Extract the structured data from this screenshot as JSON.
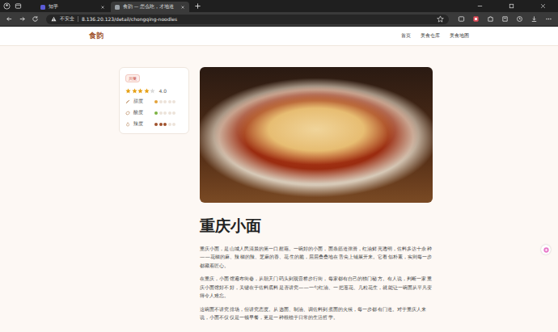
{
  "browser": {
    "tabs": [
      {
        "label": "知乎",
        "selected": false,
        "color": "#5b5bd6"
      },
      {
        "label": "食韵 — 怎么吃，才地道",
        "selected": true,
        "color": "#9aa0a6"
      }
    ],
    "security": "不安全",
    "url": "8.136.20.123/detail/chongqing-noodles"
  },
  "site": {
    "logo": "食韵",
    "nav": [
      {
        "label": "首页"
      },
      {
        "label": "美食仓库"
      },
      {
        "label": "美食地图"
      }
    ]
  },
  "dish": {
    "tag": "川菜",
    "stars": 4,
    "rating": "4.0",
    "flavors": [
      {
        "label": "甜度",
        "kind": "sweet",
        "level": 0.2,
        "color": "#e3a23b"
      },
      {
        "label": "酸度",
        "kind": "sour",
        "level": 0.2,
        "color": "#7cb342"
      },
      {
        "label": "辣度",
        "kind": "spicy",
        "level": 0.6,
        "color": "#a0522d"
      }
    ],
    "title": "重庆小面",
    "paragraphs": [
      "重庆小面，是山城人民清晨的第一口慰藉。一碗好的小面，面条筋道弹滑，红油鲜亮透明，佐料多达十余种——花椒的麻、辣椒的辣、芝麻的香、花生的脆，层层叠叠地在舌尖上铺展开来。它看似朴素，实则每一步都藏着匠心。",
      "在重庆，小面馆遍布街巷，从朝天门码头到观音桥步行街，每家都有自己的独门秘方。有人说，判断一家重庆小面馆好不好，关键在于佐料底料是否讲究——一勺红油、一把葱花、几粒花生，就能让一碗面从平凡变得令人难忘。",
      "这碗面不讲究排场，但讲究态度。从选面、制油、调佐料到煮面的火候，每一步都有门道。对于重庆人来说，小面不仅仅是一顿早餐，更是一种根植于日常的生活哲学。"
    ]
  }
}
